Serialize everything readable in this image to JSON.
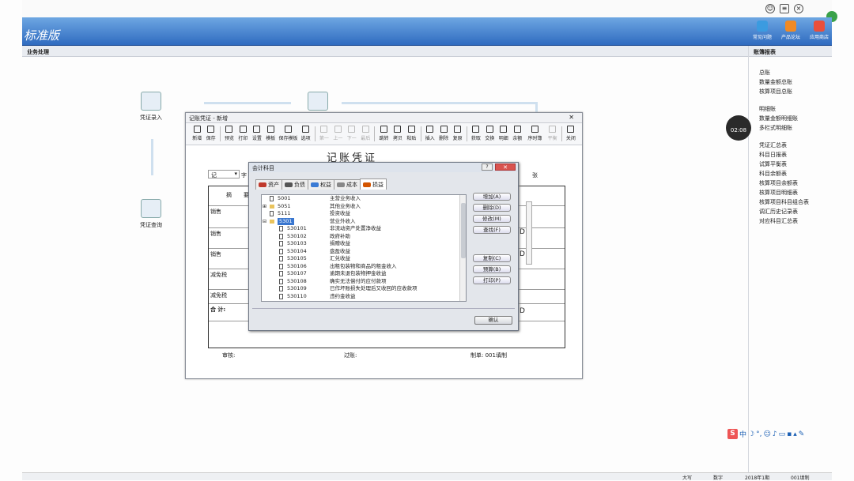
{
  "app": {
    "brand": "标准版",
    "header_buttons": [
      {
        "label": "常见问题",
        "color": "#3b9be0"
      },
      {
        "label": "产品论坛",
        "color": "#f08a24"
      },
      {
        "label": "应用商店",
        "color": "#e94f3b"
      }
    ],
    "left_subheader": "业务处理",
    "right_subheader": "账簿报表"
  },
  "flow": {
    "voucher_entry": "凭证录入",
    "voucher_query": "凭证查询"
  },
  "right_reports": [
    [
      "总账",
      "数量金额总账",
      "核算项目总账"
    ],
    [
      "明细账",
      "数量金额明细账",
      "多栏式明细账"
    ],
    [
      "凭证汇总表",
      "科目日报表",
      "试算平衡表",
      "科目余额表",
      "核算项目余额表",
      "核算项目明细表",
      "核算项目科目组合表",
      "调汇历史记录表",
      "对应科目汇总表"
    ]
  ],
  "timer": "02:08",
  "voucher_window": {
    "title": "记账凭证 - 新增",
    "heading": "记账凭证",
    "type_select": "记",
    "zi_label": "字",
    "zhang_label": "张",
    "summary_header": "摘",
    "summary_header2": "要",
    "rows": [
      "销售",
      "销售",
      "销售",
      "减免税",
      "减免税"
    ],
    "total_label": "合 计:",
    "footer": {
      "review": "审核:",
      "posting": "过账:",
      "maker": "制单: 001填制"
    },
    "toolbar": [
      {
        "label": "新增",
        "disabled": false
      },
      {
        "label": "保存",
        "disabled": false
      },
      {
        "sep": true
      },
      {
        "label": "预览",
        "disabled": false
      },
      {
        "label": "打印",
        "disabled": false
      },
      {
        "label": "设置",
        "disabled": false
      },
      {
        "label": "模板",
        "disabled": false
      },
      {
        "label": "保存模板",
        "disabled": false
      },
      {
        "label": "选项",
        "disabled": false
      },
      {
        "sep": true
      },
      {
        "label": "第一",
        "disabled": true
      },
      {
        "label": "上一",
        "disabled": true
      },
      {
        "label": "下一",
        "disabled": true
      },
      {
        "label": "最后",
        "disabled": true
      },
      {
        "sep": true
      },
      {
        "label": "跳转",
        "disabled": false
      },
      {
        "label": "拷贝",
        "disabled": false
      },
      {
        "label": "粘贴",
        "disabled": false
      },
      {
        "sep": true
      },
      {
        "label": "插入",
        "disabled": false
      },
      {
        "label": "删除",
        "disabled": false
      },
      {
        "label": "复原",
        "disabled": false
      },
      {
        "sep": true
      },
      {
        "label": "获取",
        "disabled": false
      },
      {
        "label": "交换",
        "disabled": false
      },
      {
        "label": "明细",
        "disabled": false
      },
      {
        "label": "余额",
        "disabled": false
      },
      {
        "label": "序时簿",
        "disabled": false
      },
      {
        "label": "平衡",
        "disabled": true
      },
      {
        "sep": true
      },
      {
        "label": "关闭",
        "disabled": false
      }
    ]
  },
  "account_dialog": {
    "title": "会计科目",
    "tabs": [
      {
        "label": "资产",
        "color": "#c0392b"
      },
      {
        "label": "负债",
        "color": "#555"
      },
      {
        "label": "权益",
        "color": "#3a7bd5"
      },
      {
        "label": "成本",
        "color": "#888"
      },
      {
        "label": "损益",
        "color": "#d35400",
        "active": true
      }
    ],
    "tree": [
      {
        "code": "5001",
        "name": "主营业务收入",
        "level": 0,
        "type": "page"
      },
      {
        "code": "5051",
        "name": "其他业务收入",
        "level": 0,
        "type": "folder",
        "expand": "+"
      },
      {
        "code": "5111",
        "name": "投资收益",
        "level": 0,
        "type": "page"
      },
      {
        "code": "5301",
        "name": "营业外收入",
        "level": 0,
        "type": "folder",
        "expand": "-",
        "selected": true
      },
      {
        "code": "530101",
        "name": "非流动资产处置净收益",
        "level": 1,
        "type": "page"
      },
      {
        "code": "530102",
        "name": "政府补助",
        "level": 1,
        "type": "page"
      },
      {
        "code": "530103",
        "name": "捐赠收益",
        "level": 1,
        "type": "page"
      },
      {
        "code": "530104",
        "name": "盘盈收益",
        "level": 1,
        "type": "page"
      },
      {
        "code": "530105",
        "name": "汇兑收益",
        "level": 1,
        "type": "page"
      },
      {
        "code": "530106",
        "name": "出租包装物和商品的租金收入",
        "level": 1,
        "type": "page"
      },
      {
        "code": "530107",
        "name": "逾期未退包装物押金收益",
        "level": 1,
        "type": "page"
      },
      {
        "code": "530108",
        "name": "确实无法偿付的应付款项",
        "level": 1,
        "type": "page"
      },
      {
        "code": "530109",
        "name": "已作坏账损失处理后又收回的应收款项",
        "level": 1,
        "type": "page"
      },
      {
        "code": "530110",
        "name": "违约金收益",
        "level": 1,
        "type": "page"
      }
    ],
    "buttons": [
      "增加(A)",
      "删除(D)",
      "修改(M)",
      "查找(F)",
      "复制(C)",
      "预算(B)",
      "打印(P)"
    ],
    "ok": "确认"
  },
  "status_bar": [
    "大写",
    "数字",
    "2018年1期",
    "001填制"
  ]
}
